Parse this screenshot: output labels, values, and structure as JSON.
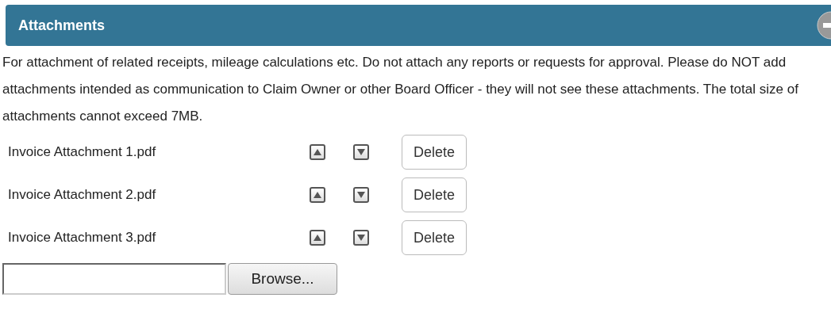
{
  "panel": {
    "title": "Attachments",
    "expanded": true
  },
  "description": "For attachment of related receipts, mileage calculations etc. Do not attach any reports or requests for approval. Please do NOT add attachments intended as communication to Claim Owner or other Board Officer - they will not see these attachments. The total size of attachments cannot exceed 7MB.",
  "attachments": [
    {
      "name": "Invoice Attachment 1.pdf",
      "delete_label": "Delete"
    },
    {
      "name": "Invoice Attachment 2.pdf",
      "delete_label": "Delete"
    },
    {
      "name": "Invoice Attachment 3.pdf",
      "delete_label": "Delete"
    }
  ],
  "upload": {
    "button": "Browse..."
  }
}
